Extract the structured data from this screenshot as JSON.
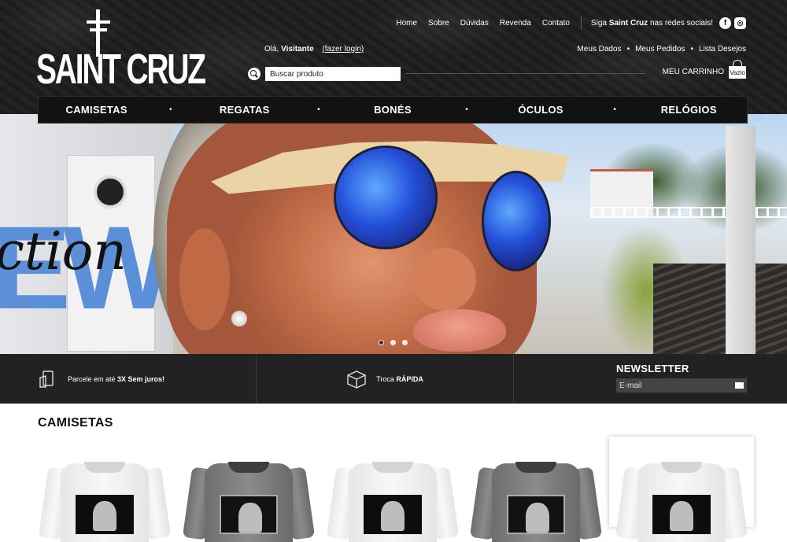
{
  "brand": {
    "name": "SAINT CRUZ"
  },
  "topnav": {
    "links": [
      "Home",
      "Sobre",
      "Dúvidas",
      "Revenda",
      "Contato"
    ],
    "social_prefix": "Siga ",
    "social_brand": "Saint Cruz",
    "social_suffix": " nas redes sociais!",
    "facebook_glyph": "f",
    "instagram_glyph": "◎"
  },
  "greeting": {
    "hello": "Olá, ",
    "user": "Visitante",
    "login_link": "(fazer login)"
  },
  "account_links": [
    "Meus Dados",
    "Meus Pedidos",
    "Lista Desejos"
  ],
  "search": {
    "placeholder": "Buscar produto"
  },
  "cart": {
    "label": "MEU CARRINHO",
    "status": "Vazio"
  },
  "mainnav": [
    "CAMISETAS",
    "REGATAS",
    "BONÉS",
    "ÓCULOS",
    "RELÓGIOS"
  ],
  "hero": {
    "overlay_big": "EW",
    "overlay_script": "ction",
    "slides": 3,
    "active_slide": 1
  },
  "infobar": {
    "installments_prefix": "Parcele em até ",
    "installments_bold": "3X Sem juros!",
    "exchange_prefix": "Troca ",
    "exchange_bold": "RÁPIDA",
    "newsletter_title": "NEWSLETTER",
    "newsletter_placeholder": "E-mail"
  },
  "section": {
    "title": "CAMISETAS"
  },
  "products": [
    {
      "color": "white"
    },
    {
      "color": "grey"
    },
    {
      "color": "white"
    },
    {
      "color": "grey"
    },
    {
      "color": "white",
      "featured": true
    }
  ],
  "icons": [
    "facebook-icon",
    "instagram-icon",
    "search-icon",
    "shopping-bag-icon",
    "card-payment-icon",
    "box-icon",
    "envelope-icon"
  ]
}
